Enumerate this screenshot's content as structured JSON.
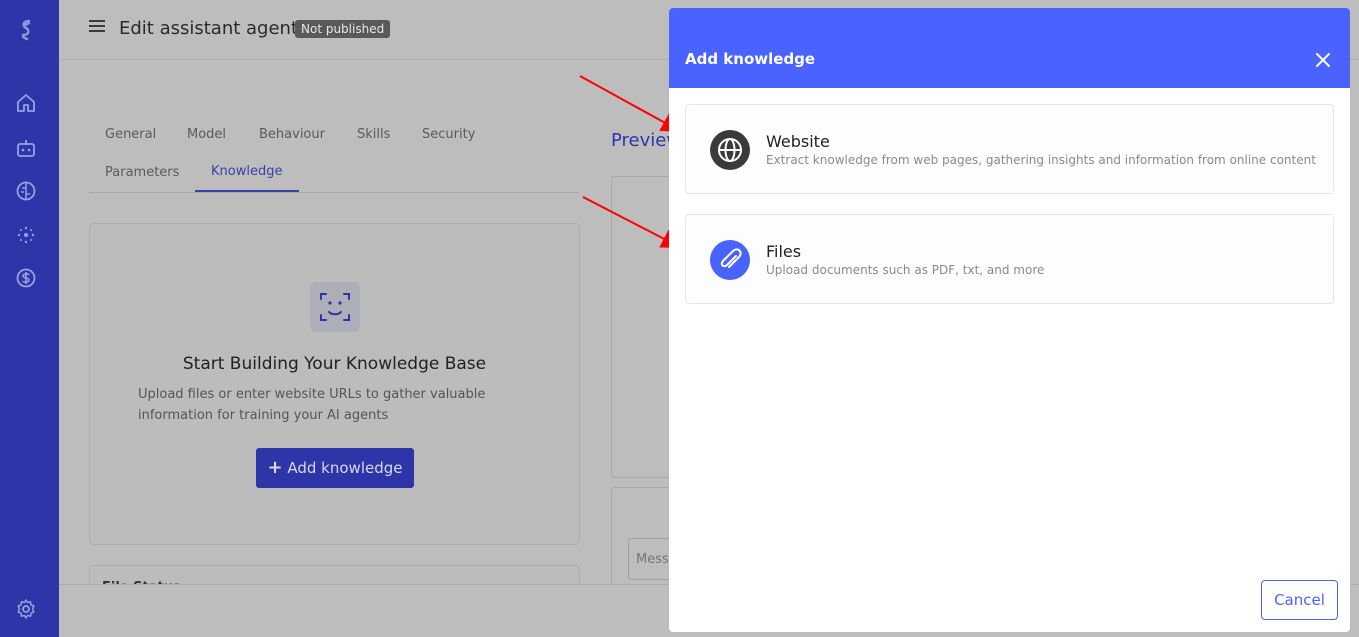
{
  "header": {
    "title": "Edit assistant agent",
    "status": "Not published"
  },
  "tabs": [
    {
      "label": "General"
    },
    {
      "label": "Model"
    },
    {
      "label": "Behaviour"
    },
    {
      "label": "Skills"
    },
    {
      "label": "Security"
    },
    {
      "label": "Parameters"
    },
    {
      "label": "Knowledge",
      "active": true
    }
  ],
  "knowledge_empty": {
    "title": "Start Building Your Knowledge Base",
    "description": "Upload files or enter website URLs to gather valuable information for training your AI agents",
    "button_label": "Add knowledge"
  },
  "lower_card": {
    "title": "File Status"
  },
  "preview": {
    "title": "Preview",
    "message_placeholder": "Message"
  },
  "modal": {
    "title": "Add knowledge",
    "options": [
      {
        "title": "Website",
        "description": "Extract knowledge from web pages, gathering insights and information from online content",
        "icon": "globe-icon",
        "icon_bg": "#3a3a3a"
      },
      {
        "title": "Files",
        "description": "Upload documents such as PDF, txt, and more",
        "icon": "paperclip-icon",
        "icon_bg": "#4a63ff"
      }
    ],
    "cancel_label": "Cancel"
  },
  "colors": {
    "sidebar": "#2d35a8",
    "modal_header": "#4a63ff",
    "annotation_arrow": "#ff0000"
  }
}
